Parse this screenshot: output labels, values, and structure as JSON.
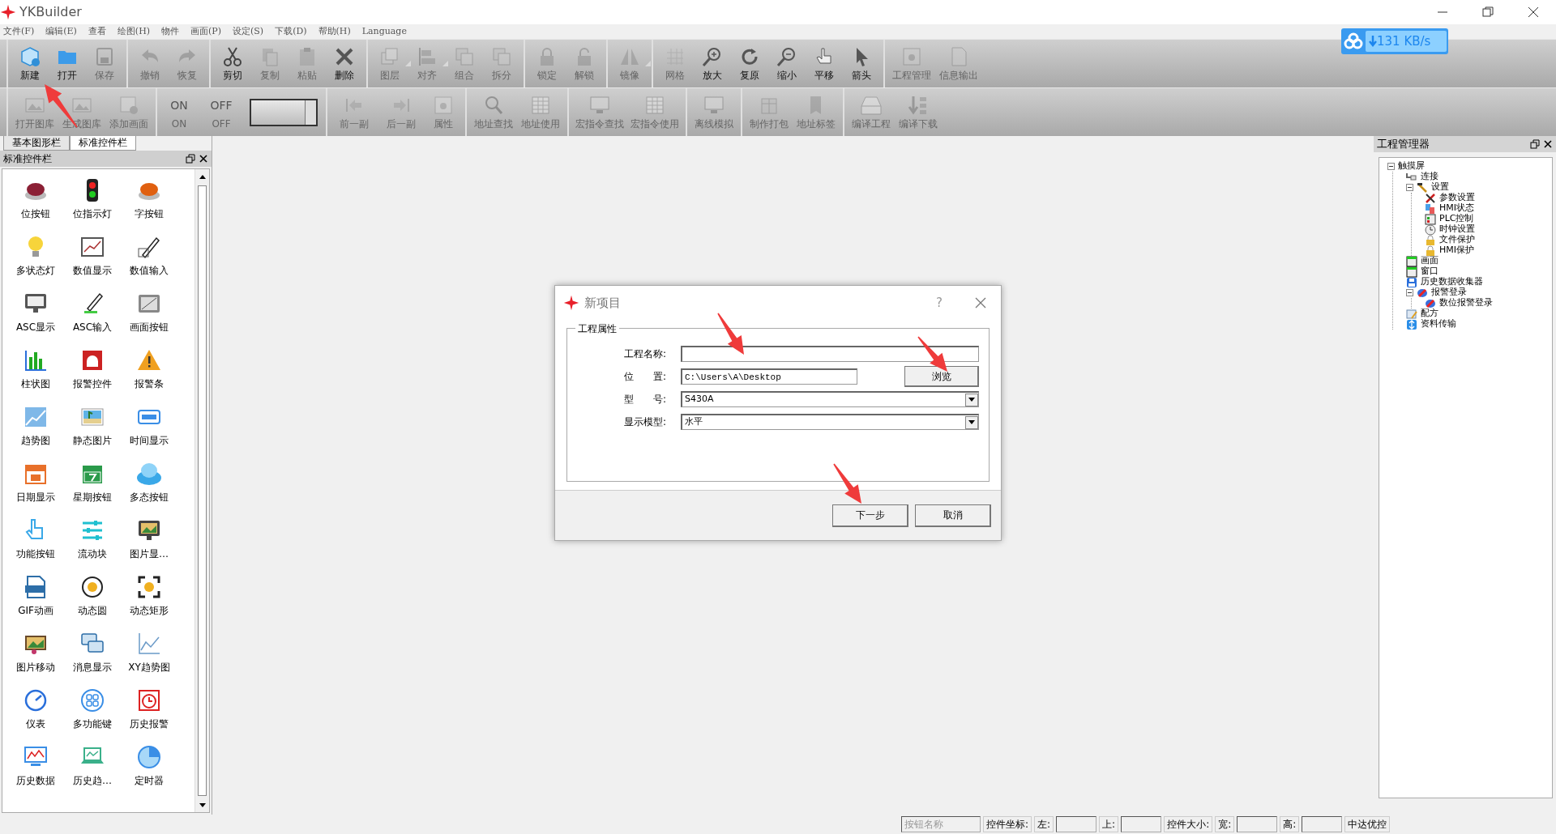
{
  "window": {
    "title": "YKBuilder"
  },
  "menu": [
    "文件(F)",
    "编辑(E)",
    "查看",
    "绘图(H)",
    "物件",
    "画面(P)",
    "设定(S)",
    "下载(D)",
    "帮助(H)",
    "Language"
  ],
  "toolbar_1": [
    {
      "items": [
        {
          "label": "新建",
          "disabled": false,
          "dropdown": false
        },
        {
          "label": "打开",
          "disabled": false,
          "dropdown": false
        },
        {
          "label": "保存",
          "disabled": true,
          "dropdown": false
        }
      ]
    },
    {
      "items": [
        {
          "label": "撤销",
          "disabled": true,
          "dropdown": false
        },
        {
          "label": "恢复",
          "disabled": true,
          "dropdown": false
        }
      ]
    },
    {
      "items": [
        {
          "label": "剪切",
          "disabled": false,
          "dropdown": false
        },
        {
          "label": "复制",
          "disabled": true,
          "dropdown": false
        },
        {
          "label": "粘贴",
          "disabled": true,
          "dropdown": false
        },
        {
          "label": "删除",
          "disabled": false,
          "dropdown": false
        }
      ]
    },
    {
      "items": [
        {
          "label": "图层",
          "disabled": true,
          "dropdown": true
        },
        {
          "label": "对齐",
          "disabled": true,
          "dropdown": true
        },
        {
          "label": "组合",
          "disabled": true,
          "dropdown": false
        },
        {
          "label": "拆分",
          "disabled": true,
          "dropdown": false
        }
      ]
    },
    {
      "items": [
        {
          "label": "锁定",
          "disabled": true,
          "dropdown": false
        },
        {
          "label": "解锁",
          "disabled": true,
          "dropdown": false
        }
      ]
    },
    {
      "items": [
        {
          "label": "镜像",
          "disabled": true,
          "dropdown": true
        }
      ]
    },
    {
      "items": [
        {
          "label": "网格",
          "disabled": true,
          "dropdown": false
        },
        {
          "label": "放大",
          "disabled": false,
          "dropdown": false
        },
        {
          "label": "复原",
          "disabled": false,
          "dropdown": false
        },
        {
          "label": "缩小",
          "disabled": false,
          "dropdown": false
        },
        {
          "label": "平移",
          "disabled": false,
          "dropdown": false
        },
        {
          "label": "箭头",
          "disabled": false,
          "dropdown": false
        }
      ]
    },
    {
      "items": [
        {
          "label": "工程管理",
          "disabled": true,
          "dropdown": false
        },
        {
          "label": "信息输出",
          "disabled": true,
          "dropdown": false
        }
      ]
    }
  ],
  "toolbar_2": [
    {
      "items": [
        {
          "kind": "button",
          "label": "打开图库"
        },
        {
          "kind": "button",
          "label": "生成图库"
        },
        {
          "kind": "button",
          "label": "添加画面"
        }
      ]
    },
    {
      "items": [
        {
          "kind": "toggle_text",
          "icon_text": "ON",
          "label": "ON"
        },
        {
          "kind": "toggle_text",
          "icon_text": "OFF",
          "label": "OFF"
        },
        {
          "kind": "combo"
        }
      ]
    },
    {
      "items": [
        {
          "kind": "button",
          "label": "前一副"
        },
        {
          "kind": "button",
          "label": "后一副"
        },
        {
          "kind": "button",
          "label": "属性"
        }
      ]
    },
    {
      "items": [
        {
          "kind": "button",
          "label": "地址查找"
        },
        {
          "kind": "button",
          "label": "地址使用"
        }
      ]
    },
    {
      "items": [
        {
          "kind": "button",
          "label": "宏指令查找"
        },
        {
          "kind": "button",
          "label": "宏指令使用"
        }
      ]
    },
    {
      "items": [
        {
          "kind": "button",
          "label": "离线模拟"
        }
      ]
    },
    {
      "items": [
        {
          "kind": "button",
          "label": "制作打包"
        },
        {
          "kind": "button",
          "label": "地址标签"
        }
      ]
    },
    {
      "items": [
        {
          "kind": "button",
          "label": "编译工程"
        },
        {
          "kind": "button",
          "label": "编译下载"
        }
      ]
    }
  ],
  "speed_widget": {
    "text": "131 KB/s"
  },
  "left_tabs": [
    {
      "label": "基本图形栏",
      "selected": false
    },
    {
      "label": "标准控件栏",
      "selected": true
    }
  ],
  "control_panel": {
    "title": "标准控件栏",
    "items": [
      "位按钮",
      "位指示灯",
      "字按钮",
      "多状态灯",
      "数值显示",
      "数值输入",
      "ASC显示",
      "ASC输入",
      "画面按钮",
      "柱状图",
      "报警控件",
      "报警条",
      "趋势图",
      "静态图片",
      "时间显示",
      "日期显示",
      "星期按钮",
      "多态按钮",
      "功能按钮",
      "流动块",
      "图片显…",
      "GIF动画",
      "动态圆",
      "动态矩形",
      "图片移动",
      "消息显示",
      "XY趋势图",
      "仪表",
      "多功能键",
      "历史报警",
      "历史数据",
      "历史趋…",
      "定时器"
    ]
  },
  "dialog": {
    "title": "新项目",
    "help": "?",
    "group_title": "工程属性",
    "fields": [
      {
        "kind": "input",
        "label": "工程名称:"
      },
      {
        "kind": "input_browse",
        "label": "位　　置:",
        "value": "C:\\Users\\A\\Desktop",
        "button": "浏览"
      },
      {
        "kind": "select",
        "label": "型　　号:",
        "value": "S430A"
      },
      {
        "kind": "select",
        "label": "显示模型:",
        "value": "水平"
      }
    ],
    "buttons": [
      "下一步",
      "取消"
    ]
  },
  "project_manager": {
    "title": "工程管理器",
    "tree": [
      {
        "label": "触摸屏",
        "expanded": true,
        "children": [
          {
            "label": "连接"
          },
          {
            "label": "设置",
            "expanded": true,
            "children": [
              {
                "label": "参数设置"
              },
              {
                "label": "HMI状态"
              },
              {
                "label": "PLC控制"
              },
              {
                "label": "时钟设置"
              },
              {
                "label": "文件保护"
              },
              {
                "label": "HMI保护"
              }
            ]
          },
          {
            "label": "画面"
          },
          {
            "label": "窗口"
          },
          {
            "label": "历史数据收集器"
          },
          {
            "label": "报警登录",
            "expanded": true,
            "children": [
              {
                "label": "数位报警登录"
              }
            ]
          },
          {
            "label": "配方"
          },
          {
            "label": "资料传输"
          }
        ]
      }
    ]
  },
  "status_bar": [
    {
      "kind": "field",
      "placeholder": "按钮名称"
    },
    {
      "kind": "label",
      "text": "控件坐标:"
    },
    {
      "kind": "label",
      "text": "左:"
    },
    {
      "kind": "field"
    },
    {
      "kind": "label",
      "text": "上:"
    },
    {
      "kind": "field"
    },
    {
      "kind": "label",
      "text": "控件大小:"
    },
    {
      "kind": "label",
      "text": "宽:"
    },
    {
      "kind": "field"
    },
    {
      "kind": "label",
      "text": "高:"
    },
    {
      "kind": "field"
    },
    {
      "kind": "label",
      "text": "中达优控"
    }
  ]
}
